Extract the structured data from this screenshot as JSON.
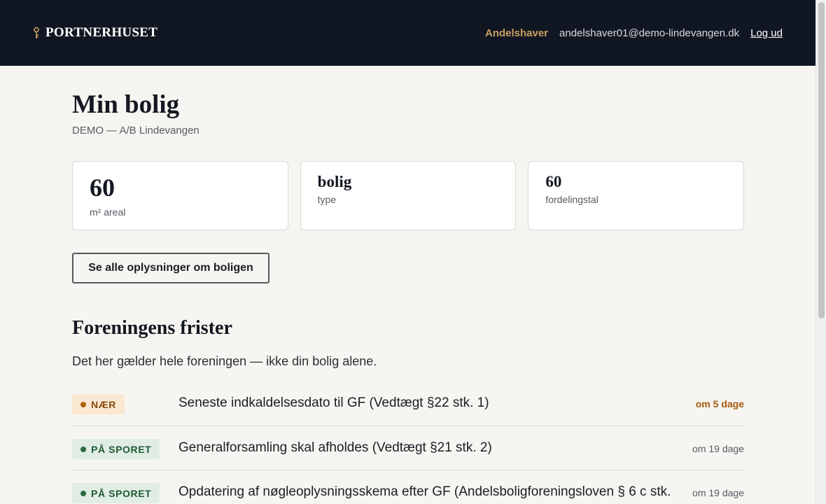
{
  "header": {
    "brand": "PORTNERHUSET",
    "role": "Andelshaver",
    "email": "andelshaver01@demo-lindevangen.dk",
    "logout": "Log ud"
  },
  "page": {
    "title": "Min bolig",
    "subtitle": "DEMO — A/B Lindevangen"
  },
  "stats": [
    {
      "value": "60",
      "label": "m² areal"
    },
    {
      "value": "bolig",
      "label": "type"
    },
    {
      "value": "60",
      "label": "fordelingstal"
    }
  ],
  "details_button": "Se alle oplysninger om boligen",
  "deadlines_section": {
    "title": "Foreningens frister",
    "lead": "Det her gælder hele foreningen — ikke din bolig alene.",
    "items": [
      {
        "status": "NÆR",
        "status_kind": "near",
        "title": "Seneste indkaldelsesdato til GF (Vedtægt §22 stk. 1)",
        "due": "om 5 dage"
      },
      {
        "status": "PÅ SPORET",
        "status_kind": "track",
        "title": "Generalforsamling skal afholdes (Vedtægt §21 stk. 2)",
        "due": "om 19 dage"
      },
      {
        "status": "PÅ SPORET",
        "status_kind": "track",
        "title": "Opdatering af nøgleoplysningsskema efter GF (Andelsboligforeningsloven § 6 c stk.",
        "due": "om 19 dage"
      }
    ]
  },
  "colors": {
    "header_bg": "#111722",
    "accent_gold": "#c9a062",
    "page_bg": "#f6f5f1",
    "near_badge_bg": "#fbe8d2",
    "track_badge_bg": "#e0ede4"
  },
  "icons": {
    "brand": "key-icon"
  }
}
